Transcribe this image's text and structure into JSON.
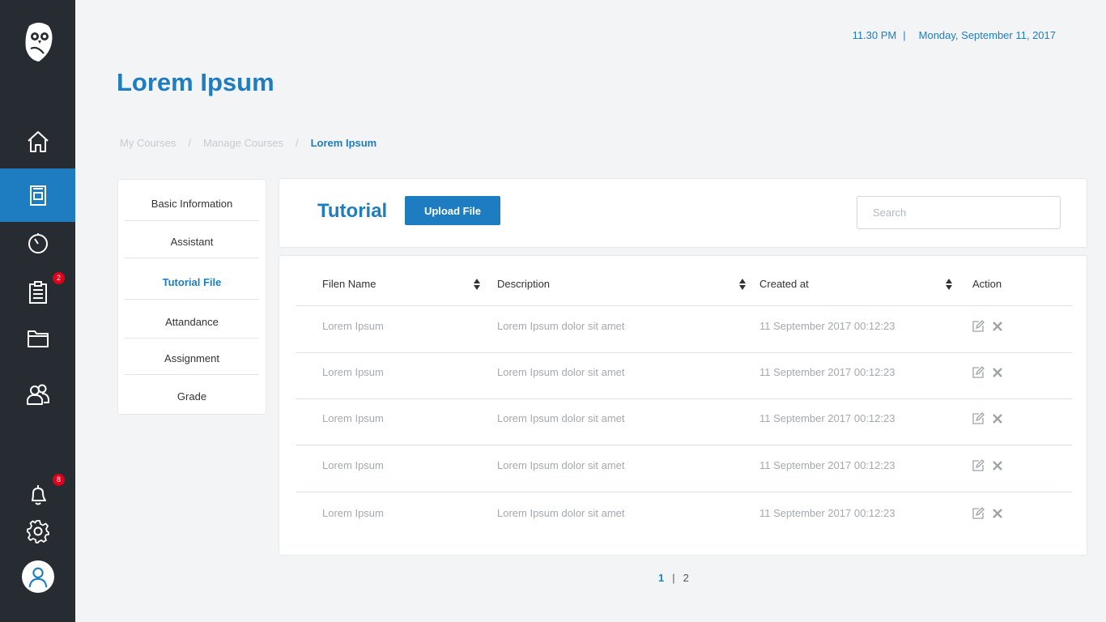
{
  "header": {
    "time": "11.30 PM",
    "separator": "|",
    "date": "Monday, September 11, 2017",
    "title": "Lorem Ipsum"
  },
  "breadcrumb": {
    "items": [
      "My Courses",
      "Manage Courses",
      "Lorem Ipsum"
    ],
    "separator": "/"
  },
  "sidebar": {
    "badges": {
      "tasks": "2",
      "notifications": "8"
    },
    "active_color": "#1e7dc1"
  },
  "menu": {
    "items": [
      {
        "label": "Basic Information"
      },
      {
        "label": "Assistant"
      },
      {
        "label": "Tutorial File"
      },
      {
        "label": "Attandance"
      },
      {
        "label": "Assignment"
      },
      {
        "label": "Grade"
      }
    ]
  },
  "card": {
    "title": "Tutorial",
    "upload_label": "Upload File",
    "search_placeholder": "Search"
  },
  "table": {
    "headers": [
      "Filen Name",
      "Description",
      "Created at",
      "Action"
    ],
    "rows": [
      {
        "name": "Lorem Ipsum",
        "description": "Lorem Ipsum dolor sit amet",
        "created": "11 September 2017 00:12:23"
      },
      {
        "name": "Lorem Ipsum",
        "description": "Lorem Ipsum dolor sit amet",
        "created": "11 September 2017 00:12:23"
      },
      {
        "name": "Lorem Ipsum",
        "description": "Lorem Ipsum dolor sit amet",
        "created": "11 September 2017 00:12:23"
      },
      {
        "name": "Lorem Ipsum",
        "description": "Lorem Ipsum dolor sit amet",
        "created": "11 September 2017 00:12:23"
      },
      {
        "name": "Lorem Ipsum",
        "description": "Lorem Ipsum dolor sit amet",
        "created": "11 September 2017 00:12:23"
      }
    ]
  },
  "pagination": {
    "pages": [
      "1",
      "2"
    ],
    "separator": "|"
  }
}
